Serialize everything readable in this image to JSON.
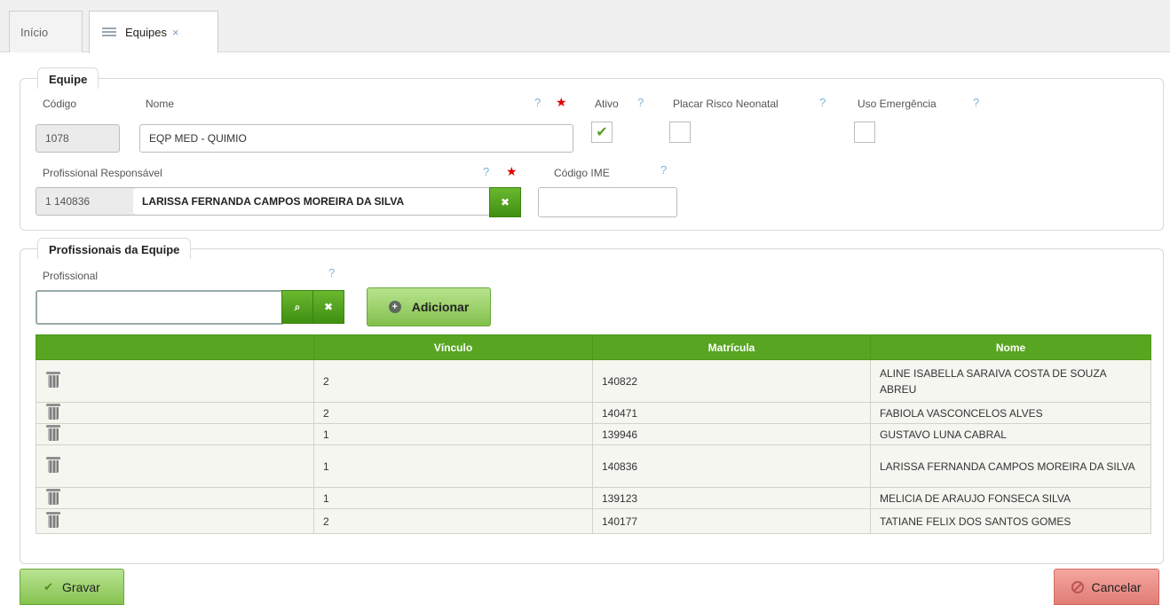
{
  "tabs": [
    {
      "label": "Início"
    },
    {
      "label": "Equipes",
      "close": "×"
    }
  ],
  "equipe": {
    "legend": "Equipe",
    "codigo_label": "Código",
    "codigo_value": "1078",
    "nome_label": "Nome",
    "nome_value": "EQP MED - QUIMIO",
    "ativo_label": "Ativo",
    "ativo_checked": true,
    "placar_label": "Placar Risco Neonatal",
    "uso_label": "Uso Emergência",
    "prof_resp_label": "Profissional Responsável",
    "prof_resp_code": "1 140836",
    "prof_resp_name": "LARISSA FERNANDA CAMPOS MOREIRA DA SILVA",
    "codigo_ime_label": "Código IME",
    "codigo_ime_value": "",
    "help": "?",
    "required": "★"
  },
  "profissionais": {
    "legend": "Profissionais da Equipe",
    "profissional_label": "Profissional",
    "profissional_value": "",
    "add_label": "Adicionar",
    "columns": [
      "",
      "Vínculo",
      "Matrícula",
      "Nome"
    ],
    "rows": [
      {
        "vinculo": "2",
        "matricula": "140822",
        "nome": "ALINE ISABELLA SARAIVA COSTA DE SOUZA ABREU"
      },
      {
        "vinculo": "2",
        "matricula": "140471",
        "nome": "FABIOLA VASCONCELOS ALVES"
      },
      {
        "vinculo": "1",
        "matricula": "139946",
        "nome": "GUSTAVO LUNA CABRAL"
      },
      {
        "vinculo": "1",
        "matricula": "140836",
        "nome": "LARISSA FERNANDA CAMPOS MOREIRA DA SILVA"
      },
      {
        "vinculo": "1",
        "matricula": "139123",
        "nome": "MELICIA DE ARAUJO FONSECA SILVA"
      },
      {
        "vinculo": "2",
        "matricula": "140177",
        "nome": "TATIANE FELIX DOS SANTOS GOMES"
      }
    ]
  },
  "footer": {
    "save_label": "Gravar",
    "cancel_label": "Cancelar"
  }
}
